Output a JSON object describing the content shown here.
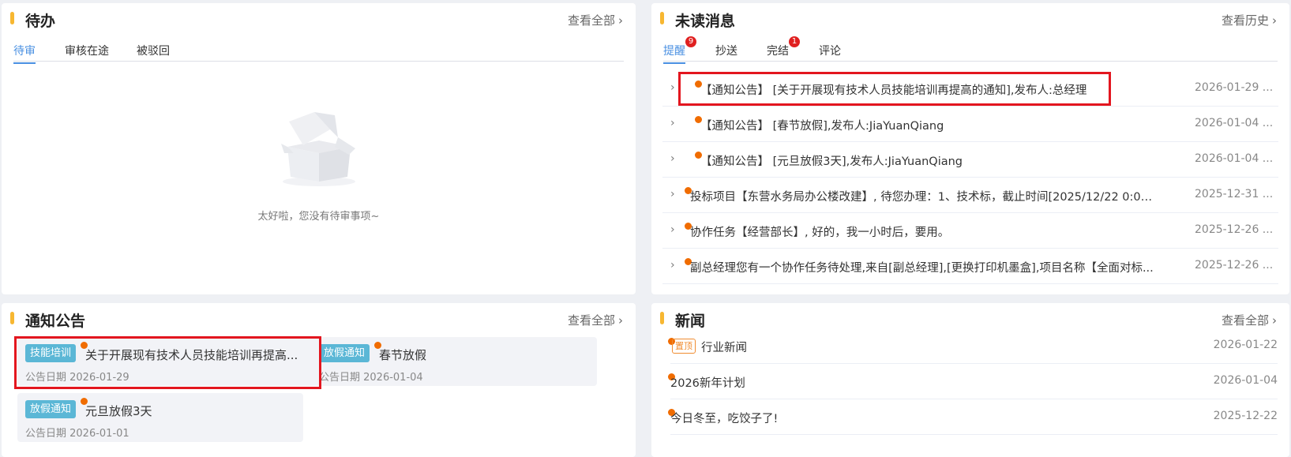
{
  "todo": {
    "title": "待办",
    "view_all": "查看全部",
    "tabs": [
      {
        "label": "待审",
        "active": true
      },
      {
        "label": "审核在途",
        "active": false
      },
      {
        "label": "被驳回",
        "active": false
      }
    ],
    "empty_text": "太好啦，您没有待审事项~"
  },
  "messages": {
    "title": "未读消息",
    "view_history": "查看历史",
    "tabs": [
      {
        "label": "提醒",
        "badge": "9",
        "active": true
      },
      {
        "label": "抄送",
        "badge": "",
        "active": false
      },
      {
        "label": "完结",
        "badge": "1",
        "active": false
      },
      {
        "label": "评论",
        "badge": "",
        "active": false
      }
    ],
    "items": [
      {
        "text": "【通知公告】 [关于开展现有技术人员技能培训再提高的通知],发布人:总经理",
        "date": "2026-01-29 ..."
      },
      {
        "text": "【通知公告】 [春节放假],发布人:JiaYuanQiang",
        "date": "2026-01-04 ..."
      },
      {
        "text": "【通知公告】 [元旦放假3天],发布人:JiaYuanQiang",
        "date": "2026-01-04 ..."
      },
      {
        "text": "投标项目【东营水务局办公楼改建】, 待您办理：1、技术标，截止时间[2025/12/22 0:00:...",
        "date": "2025-12-31 ..."
      },
      {
        "text": "协作任务【经营部长】, 好的，我一小时后，要用。",
        "date": "2025-12-26 ..."
      },
      {
        "text": "副总经理您有一个协作任务待处理,来自[副总经理],[更换打印机墨盒],项目名称【全面对标...",
        "date": "2025-12-26 ..."
      }
    ]
  },
  "notices": {
    "title": "通知公告",
    "view_all": "查看全部",
    "items": [
      {
        "tag": "技能培训",
        "title": "关于开展现有技术人员技能培训再提高...",
        "date": "公告日期 2026-01-29"
      },
      {
        "tag": "放假通知",
        "title": "春节放假",
        "date": "公告日期 2026-01-04"
      },
      {
        "tag": "放假通知",
        "title": "元旦放假3天",
        "date": "公告日期 2026-01-01"
      }
    ]
  },
  "news": {
    "title": "新闻",
    "view_all": "查看全部",
    "items": [
      {
        "pinned": true,
        "pin_label": "置顶",
        "text": "行业新闻",
        "date": "2026-01-22"
      },
      {
        "pinned": false,
        "pin_label": "",
        "text": "2026新年计划",
        "date": "2026-01-04"
      },
      {
        "pinned": false,
        "pin_label": "",
        "text": "今日冬至，吃饺子了!",
        "date": "2025-12-22"
      }
    ]
  },
  "colors": {
    "accent_bar": "#f7b731",
    "active_tab": "#4a90e2",
    "unread_dot": "#f06c00",
    "badge": "#e02020",
    "tag_bg": "#5bb7d6",
    "highlight_box": "#e3161f"
  },
  "icons": {
    "chevron": "chevron-right-icon",
    "empty": "empty-box-icon"
  }
}
